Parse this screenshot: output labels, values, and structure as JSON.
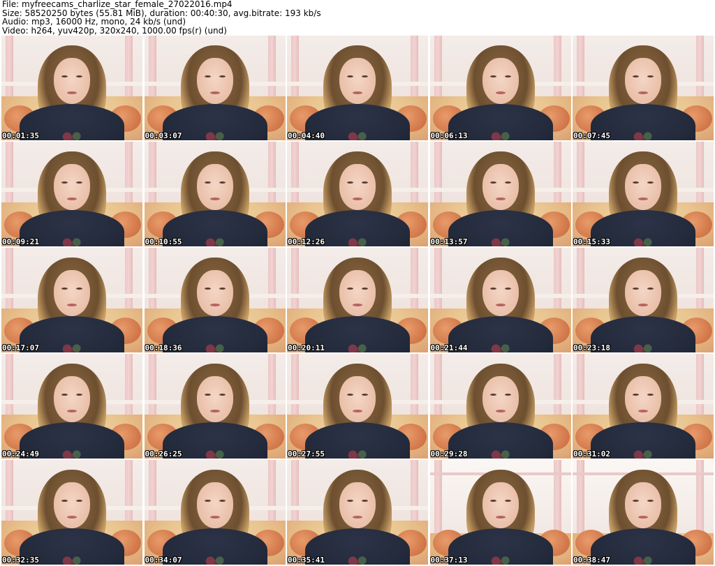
{
  "header": {
    "file": "File: myfreecams_charlize_star_female_27022016.mp4",
    "size": "Size: 58520250 bytes (55.81 MiB), duration: 00:40:30, avg.bitrate: 193 kb/s",
    "audio": "Audio: mp3, 16000 Hz, mono, 24 kb/s (und)",
    "video": "Video: h264, yuv420p, 320x240, 1000.00 fps(r) (und)"
  },
  "thumbnails": [
    {
      "timestamp": "00:01:35",
      "scene": "default"
    },
    {
      "timestamp": "00:03:07",
      "scene": "default"
    },
    {
      "timestamp": "00:04:40",
      "scene": "default"
    },
    {
      "timestamp": "00:06:13",
      "scene": "default"
    },
    {
      "timestamp": "00:07:45",
      "scene": "default"
    },
    {
      "timestamp": "00:09:21",
      "scene": "default"
    },
    {
      "timestamp": "00:10:55",
      "scene": "default"
    },
    {
      "timestamp": "00:12:26",
      "scene": "default"
    },
    {
      "timestamp": "00:13:57",
      "scene": "default"
    },
    {
      "timestamp": "00:15:33",
      "scene": "default"
    },
    {
      "timestamp": "00:17:07",
      "scene": "default"
    },
    {
      "timestamp": "00:18:36",
      "scene": "default"
    },
    {
      "timestamp": "00:20:11",
      "scene": "default"
    },
    {
      "timestamp": "00:21:44",
      "scene": "default"
    },
    {
      "timestamp": "00:23:18",
      "scene": "default"
    },
    {
      "timestamp": "00:24:49",
      "scene": "default"
    },
    {
      "timestamp": "00:26:25",
      "scene": "default"
    },
    {
      "timestamp": "00:27:55",
      "scene": "default"
    },
    {
      "timestamp": "00:29:28",
      "scene": "default"
    },
    {
      "timestamp": "00:31:02",
      "scene": "default"
    },
    {
      "timestamp": "00:32:35",
      "scene": "default"
    },
    {
      "timestamp": "00:34:07",
      "scene": "default"
    },
    {
      "timestamp": "00:35:41",
      "scene": "default"
    },
    {
      "timestamp": "00:37:13",
      "scene": "alt"
    },
    {
      "timestamp": "00:38:47",
      "scene": "alt"
    }
  ]
}
